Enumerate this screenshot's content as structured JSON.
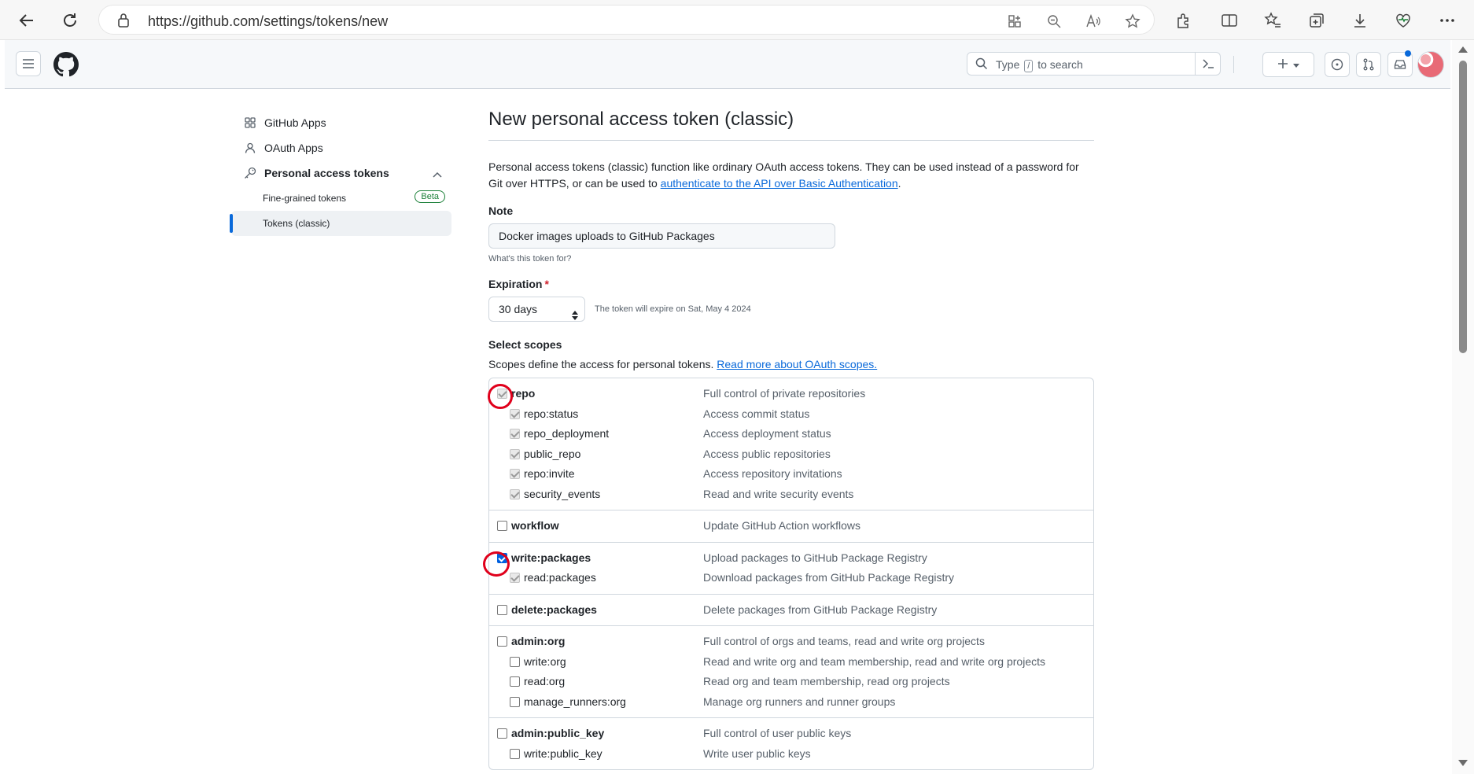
{
  "browser": {
    "url": "https://github.com/settings/tokens/new"
  },
  "header": {
    "search_prefix": "Type",
    "search_key": "/",
    "search_suffix": "to search",
    "new_label": "+"
  },
  "sidebar": {
    "items": [
      {
        "label": "GitHub Apps",
        "icon": "apps-icon"
      },
      {
        "label": "OAuth Apps",
        "icon": "person-icon"
      },
      {
        "label": "Personal access tokens",
        "icon": "key-icon"
      }
    ],
    "subitems": [
      {
        "label": "Fine-grained tokens",
        "badge": "Beta"
      },
      {
        "label": "Tokens (classic)"
      }
    ]
  },
  "main": {
    "title": "New personal access token (classic)",
    "intro_1": "Personal access tokens (classic) function like ordinary OAuth access tokens. They can be used instead of a password for Git over HTTPS, or can be used to ",
    "intro_link": "authenticate to the API over Basic Authentication",
    "intro_end": ".",
    "note_label": "Note",
    "note_value": "Docker images uploads to GitHub Packages",
    "note_hint": "What's this token for?",
    "expiration_label": "Expiration",
    "expiration_required": "*",
    "expiration_value": "30 days",
    "expiration_note": "The token will expire on Sat, May 4 2024",
    "scopes_label": "Select scopes",
    "scopes_desc": "Scopes define the access for personal tokens. ",
    "scopes_link": "Read more about OAuth scopes."
  },
  "scopes": [
    {
      "name": "repo",
      "desc": "Full control of private repositories",
      "state": "disabled-checked",
      "children": [
        {
          "name": "repo:status",
          "desc": "Access commit status",
          "state": "disabled-checked"
        },
        {
          "name": "repo_deployment",
          "desc": "Access deployment status",
          "state": "disabled-checked"
        },
        {
          "name": "public_repo",
          "desc": "Access public repositories",
          "state": "disabled-checked"
        },
        {
          "name": "repo:invite",
          "desc": "Access repository invitations",
          "state": "disabled-checked"
        },
        {
          "name": "security_events",
          "desc": "Read and write security events",
          "state": "disabled-checked"
        }
      ]
    },
    {
      "name": "workflow",
      "desc": "Update GitHub Action workflows",
      "state": "unchecked",
      "children": []
    },
    {
      "name": "write:packages",
      "desc": "Upload packages to GitHub Package Registry",
      "state": "checked",
      "children": [
        {
          "name": "read:packages",
          "desc": "Download packages from GitHub Package Registry",
          "state": "disabled-checked"
        }
      ]
    },
    {
      "name": "delete:packages",
      "desc": "Delete packages from GitHub Package Registry",
      "state": "unchecked",
      "children": []
    },
    {
      "name": "admin:org",
      "desc": "Full control of orgs and teams, read and write org projects",
      "state": "unchecked",
      "children": [
        {
          "name": "write:org",
          "desc": "Read and write org and team membership, read and write org projects",
          "state": "unchecked"
        },
        {
          "name": "read:org",
          "desc": "Read org and team membership, read org projects",
          "state": "unchecked"
        },
        {
          "name": "manage_runners:org",
          "desc": "Manage org runners and runner groups",
          "state": "unchecked"
        }
      ]
    },
    {
      "name": "admin:public_key",
      "desc": "Full control of user public keys",
      "state": "unchecked",
      "children": [
        {
          "name": "write:public_key",
          "desc": "Write user public keys",
          "state": "unchecked"
        }
      ]
    }
  ],
  "colors": {
    "link": "#0969da",
    "annotation": "#e0001b",
    "checkbox_checked": "#0060df",
    "beta": "#1a7f37"
  }
}
